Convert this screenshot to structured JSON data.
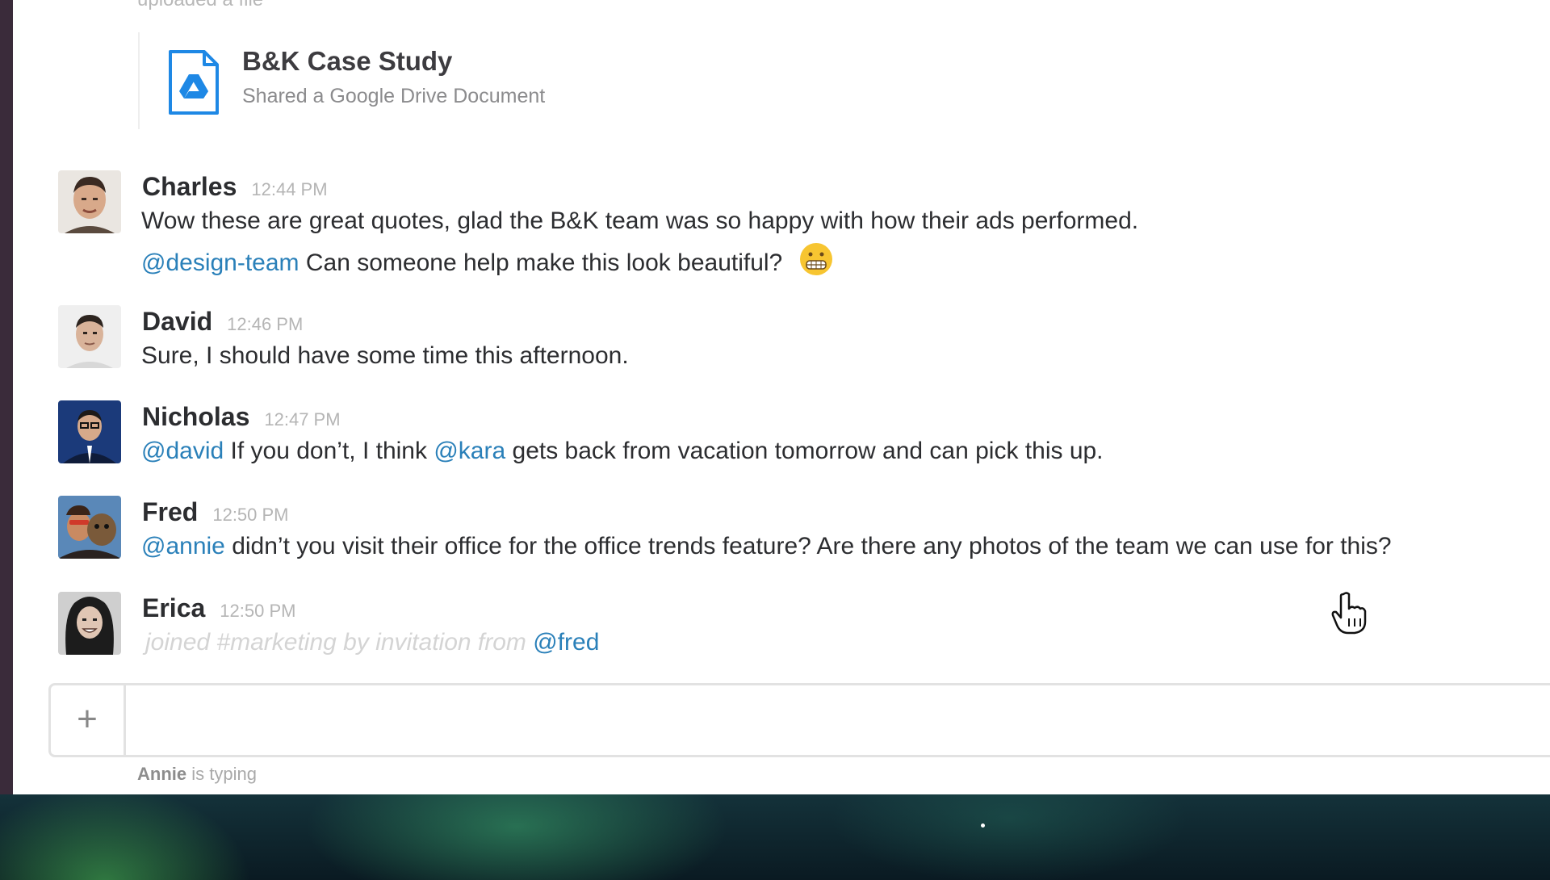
{
  "file_upload": {
    "header_text": "uploaded a file",
    "title": "B&K Case Study",
    "subtitle": "Shared a Google Drive Document"
  },
  "messages": [
    {
      "author": "Charles",
      "time": "12:44 PM",
      "line1": "Wow these are great quotes, glad the B&K team was so happy with how their ads performed.",
      "line2_mention": "@design-team",
      "line2_text": " Can someone help make this look beautiful?",
      "emoji": "grimacing-emoji"
    },
    {
      "author": "David",
      "time": "12:46 PM",
      "line1": "Sure, I should have some time this afternoon."
    },
    {
      "author": "Nicholas",
      "time": "12:47 PM",
      "mention1": "@david",
      "text1": " If you don’t, I think ",
      "mention2": "@kara",
      "text2": " gets back from vacation tomorrow and can pick this up."
    },
    {
      "author": "Fred",
      "time": "12:50 PM",
      "mention1": "@annie",
      "text1": " didn’t you visit their office for the office trends feature? Are there any photos of the team we can use for this?"
    },
    {
      "author": "Erica",
      "time": "12:50 PM",
      "system_text": "joined #marketing by invitation from ",
      "mention1": "@fred"
    }
  ],
  "composer": {
    "plus_label": "+",
    "input_value": ""
  },
  "typing": {
    "name": "Annie",
    "text": " is typing"
  },
  "colors": {
    "mention": "#2a80b9",
    "sidebar": "#3a2b3a",
    "drive_blue": "#1e88e5"
  }
}
